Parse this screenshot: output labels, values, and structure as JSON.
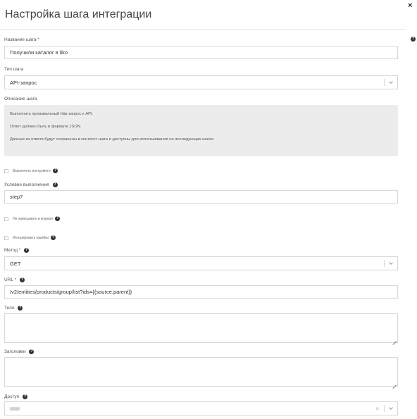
{
  "dialog": {
    "title": "Настройка шага интеграции",
    "close_icon": "×"
  },
  "help_glyph": "?",
  "required_mark": "*",
  "fields": {
    "step_name": {
      "label": "Название шага",
      "value": "Получили каталог в liko"
    },
    "step_type": {
      "label": "Тип шага",
      "value": "API-запрос"
    },
    "description": {
      "label": "Описание шага",
      "lines": [
        "Выполнить произвольный http-запрос к API.",
        "Ответ должен быть в формате JSON.",
        "Данные из ответа будут сохранены в контекст шага и доступны для использования на последующих шагах"
      ]
    },
    "disable_tool": {
      "label": "Выключить инструмент",
      "checked": false
    },
    "condition": {
      "label": "Условие выполнения",
      "value": "step7"
    },
    "no_log": {
      "label": "Не записывать в журнал",
      "checked": false
    },
    "ignore_errors": {
      "label": "Игнорировать ошибки",
      "checked": false
    },
    "method": {
      "label": "Метод",
      "value": "GET"
    },
    "url": {
      "label": "URL",
      "value": "/v2/entities/products/group/list?ids={{source.parent}}"
    },
    "body": {
      "label": "Тело",
      "value": ""
    },
    "headers": {
      "label": "Заголовки",
      "value": ""
    },
    "access": {
      "label": "Доступ",
      "clear_icon": "×"
    }
  }
}
